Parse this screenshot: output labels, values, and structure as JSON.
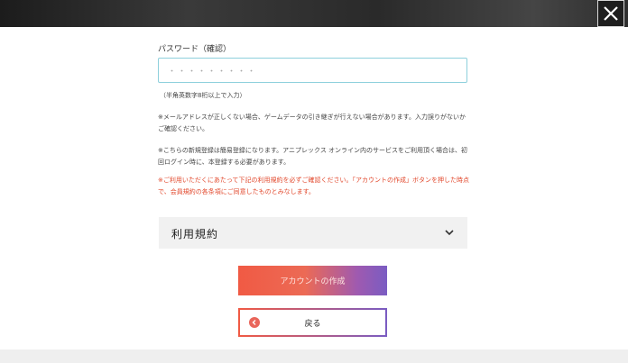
{
  "header": {
    "close_icon": "close-icon"
  },
  "form": {
    "password_confirm_label": "パスワード（確認）",
    "password_value": "・・・・・・・・・",
    "password_hint": "（半角英数字8桁以上で入力）"
  },
  "notes": {
    "note1": "※メールアドレスが正しくない場合、ゲームデータの引き継ぎが行えない場合があります。入力誤りがないかご確認ください。",
    "note2": "※こちらの新規登録は簡易登録になります。アニプレックス オンライン内のサービスをご利用頂く場合は、初回ログイン時に、本登録する必要があります。",
    "note3": "※ご利用いただくにあたって下記の利用規約を必ずご確認ください。「アカウントの作成」ボタンを押した時点で、会員規約の各条項にご同意したものとみなします。"
  },
  "terms": {
    "label": "利用規約",
    "chevron_icon": "chevron-down-icon"
  },
  "buttons": {
    "create_label": "アカウントの作成",
    "back_label": "戻る",
    "back_icon": "chevron-left-icon"
  },
  "colors": {
    "accent_red": "#f05a44",
    "accent_purple": "#7a5cc2",
    "warning_text": "#e2482c",
    "input_border": "#8ed0dc"
  }
}
